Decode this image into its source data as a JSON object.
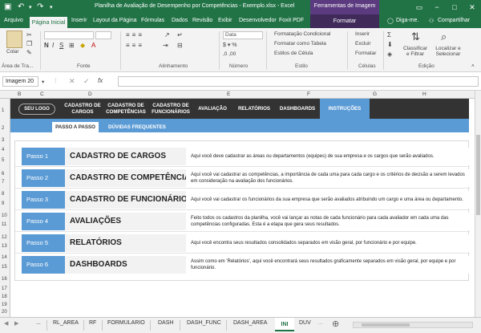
{
  "window": {
    "title": "Planilha de Avaliação de Desempenho por Competências - Exemplo.xlsx - Excel",
    "context_group": "Ferramentas de Imagem",
    "controls": [
      "−",
      "□",
      "✕"
    ]
  },
  "ribbon_tabs": [
    "Arquivo",
    "Página Inicial",
    "Inserir",
    "Layout da Página",
    "Fórmulas",
    "Dados",
    "Revisão",
    "Exibir",
    "Desenvolvedor",
    "Foxit PDF",
    "Formatar"
  ],
  "ribbon_right": {
    "tell_me": "Diga-me.",
    "share": "Compartilhar"
  },
  "ribbon": {
    "clipboard": {
      "paste": "Colar",
      "label": "Área de Tra..."
    },
    "font": {
      "label": "Fonte",
      "font_name": "",
      "font_size": ""
    },
    "alignment": {
      "label": "Alinhamento"
    },
    "number": {
      "label": "Número",
      "format": "Data"
    },
    "styles": {
      "label": "Estilo",
      "items": [
        "Formatação Condicional",
        "Formatar como Tabela",
        "Estilos de Célula"
      ]
    },
    "cells": {
      "label": "Células",
      "items": [
        "Inserir",
        "Excluir",
        "Formatar"
      ]
    },
    "editing": {
      "label": "Edição",
      "sort": "Classificar e Filtrar",
      "find": "Localizar e Selecionar"
    }
  },
  "formula_bar": {
    "name_box": "Imagem 20",
    "fx": "fx",
    "content": ""
  },
  "columns": [
    "B",
    "C",
    "D",
    "E",
    "F",
    "G",
    "H"
  ],
  "rows": [
    "1",
    "2",
    "3",
    "4",
    "5",
    "6",
    "7",
    "8",
    "9",
    "10",
    "11",
    "12",
    "13",
    "14",
    "15",
    "16",
    "17",
    "18",
    "19",
    "20",
    "21"
  ],
  "nav": {
    "logo": "SEU LOGO",
    "items": [
      "CADASTRO DE CARGOS",
      "CADASTRO DE COMPETÊNCIAS",
      "CADASTRO DE FUNCIONÁRIOS",
      "AVALIAÇÃO",
      "RELATÓRIOS",
      "DASHBOARDS",
      "INSTRUÇÕES"
    ]
  },
  "subnav": {
    "passo": "PASSO A PASSO",
    "duvidas": "DÚVIDAS FREQUENTES"
  },
  "steps": [
    {
      "label": "Passo 1",
      "title": "CADASTRO DE CARGOS",
      "desc": "Aqui você deve cadastrar as áreas ou departamentos (equipes) de sua empresa e os cargos que serão avaliados."
    },
    {
      "label": "Passo 2",
      "title": "CADASTRO DE COMPETÊNCIAS",
      "desc": "Aqui você vai cadastrar as competências, a importância de cada uma para cada cargo e os critérios de decisão a serem levados em consideração na avaliação dos funcionários."
    },
    {
      "label": "Passo 3",
      "title": "CADASTRO DE FUNCIONÁRIOS",
      "desc": "Aqui você vai cadastrar os funcionários da sua empresa que serão avaliados atribuindo um cargo e uma área ou departamento."
    },
    {
      "label": "Passo 4",
      "title": "AVALIAÇÕES",
      "desc": "Feito todos os cadastros da planilha, você vai lançar as notas de cada funcionário para cada avaliador em cada uma das competências configuradas. Esta é a etapa que gera seus resultados."
    },
    {
      "label": "Passo 5",
      "title": "RELATÓRIOS",
      "desc": "Aqui você encontra seus resultados consolidados separados em visão geral, por funcionário e por equipe."
    },
    {
      "label": "Passo 6",
      "title": "DASHBOARDS",
      "desc": "Assim como em 'Relatórios', aqui você encontrará seus resultados graficamente separados em visão geral, por equipe e por funcionário."
    }
  ],
  "sheet_tabs": [
    "...",
    "RL_AREA",
    "RF",
    "FORMULARIO",
    "DASH",
    "DASH_FUNC",
    "DASH_AREA",
    "INI",
    "DUV"
  ],
  "active_sheet": "INI",
  "colors": {
    "excel_green": "#217346",
    "nav_dark": "#333333",
    "accent_blue": "#5b9bd5",
    "context_purple": "#5b3a7f"
  }
}
